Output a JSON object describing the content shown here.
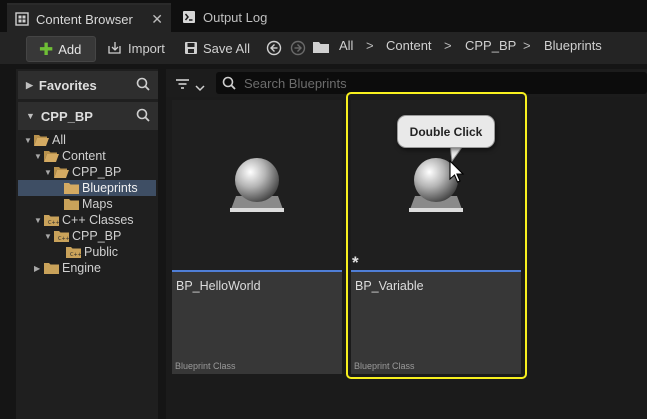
{
  "tabs": [
    {
      "label": "Content Browser",
      "close": "✕"
    },
    {
      "label": "Output Log"
    }
  ],
  "toolbar": {
    "add_label": "Add",
    "import_label": "Import",
    "save_all_label": "Save All"
  },
  "breadcrumb": [
    "All",
    "Content",
    "CPP_BP",
    "Blueprints"
  ],
  "breadcrumb_separator": ">",
  "sources": {
    "favorites_label": "Favorites",
    "project_label": "CPP_BP",
    "tree": [
      {
        "label": "All"
      },
      {
        "label": "Content"
      },
      {
        "label": "CPP_BP"
      },
      {
        "label": "Blueprints"
      },
      {
        "label": "Maps"
      },
      {
        "label": "C++ Classes"
      },
      {
        "label": "CPP_BP"
      },
      {
        "label": "Public"
      },
      {
        "label": "Engine"
      }
    ]
  },
  "search": {
    "placeholder": "Search Blueprints",
    "value": ""
  },
  "assets": [
    {
      "name": "BP_HelloWorld",
      "type": "Blueprint Class"
    },
    {
      "name": "BP_Variable",
      "type": "Blueprint Class",
      "modified_marker": "*"
    }
  ],
  "tooltip": {
    "text": "Double Click"
  },
  "colors": {
    "accent": "#4f7ed6",
    "highlight": "#f7ef1e",
    "folder": "#c9a25a",
    "add_plus": "#6fbf36",
    "selection": "#3e4e64"
  }
}
